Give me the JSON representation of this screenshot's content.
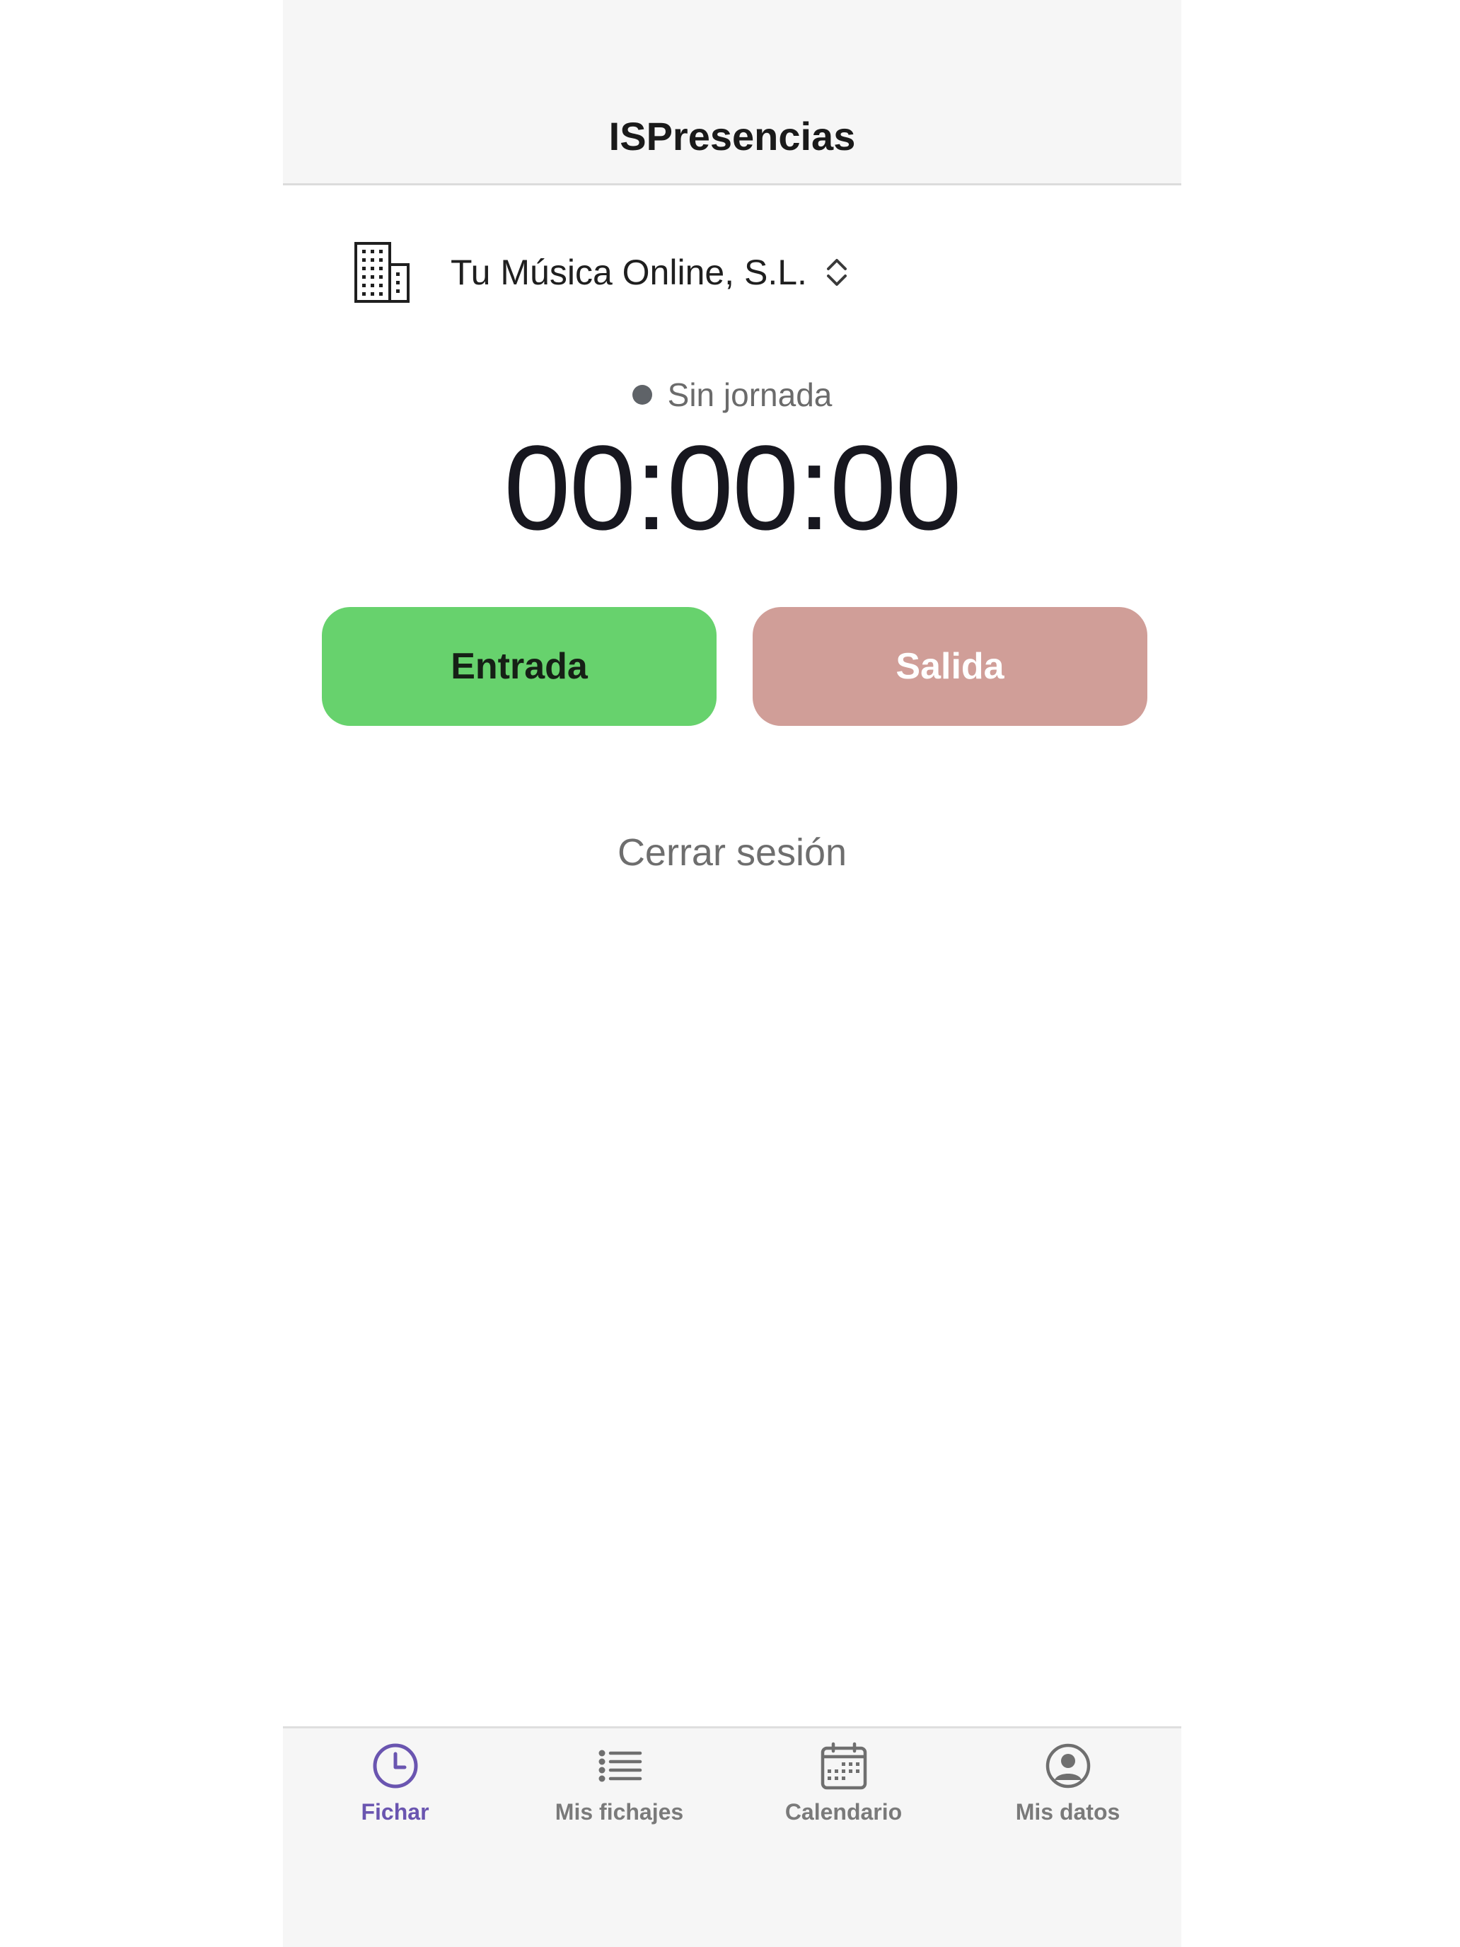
{
  "header": {
    "title": "ISPresencias"
  },
  "company": {
    "name": "Tu Música Online, S.L.",
    "icon": "building-icon",
    "selector_icon": "chevron-up-down-icon"
  },
  "status": {
    "label": "Sin jornada",
    "dot_color": "#5f6368"
  },
  "timer": {
    "value": "00:00:00"
  },
  "buttons": {
    "entrada": {
      "label": "Entrada",
      "color": "#67d26d"
    },
    "salida": {
      "label": "Salida",
      "color": "#d09e98"
    }
  },
  "logout": {
    "label": "Cerrar sesión"
  },
  "tabbar": {
    "active_color": "#6a55b0",
    "items": [
      {
        "label": "Fichar",
        "icon": "clock-icon",
        "active": true
      },
      {
        "label": "Mis fichajes",
        "icon": "list-icon",
        "active": false
      },
      {
        "label": "Calendario",
        "icon": "calendar-icon",
        "active": false
      },
      {
        "label": "Mis datos",
        "icon": "user-circle-icon",
        "active": false
      }
    ]
  }
}
